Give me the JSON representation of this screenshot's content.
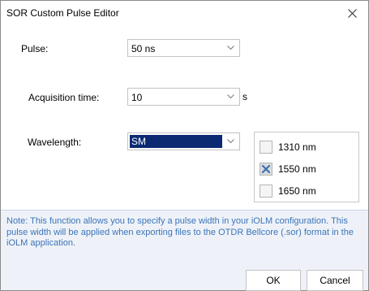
{
  "window": {
    "title": "SOR Custom Pulse Editor",
    "close_icon": "close-icon"
  },
  "form": {
    "pulse": {
      "label": "Pulse:",
      "value": "50 ns"
    },
    "acquisition": {
      "label": "Acquisition time:",
      "value": "10",
      "unit": "s"
    },
    "wavelength": {
      "label": "Wavelength:",
      "value": "SM",
      "options": [
        {
          "label": "1310 nm",
          "checked": false
        },
        {
          "label": "1550 nm",
          "checked": true
        },
        {
          "label": "1650 nm",
          "checked": false
        }
      ]
    }
  },
  "note": {
    "text": "Note: This function allows you to specify a pulse width in your iOLM configuration. This pulse width will be applied when exporting files to the OTDR Bellcore (.sor) format in the iOLM application.",
    "color": "#3b74b8"
  },
  "buttons": {
    "ok": "OK",
    "cancel": "Cancel"
  },
  "colors": {
    "selection": "#0b2a72",
    "note_background": "#eef2f8"
  }
}
